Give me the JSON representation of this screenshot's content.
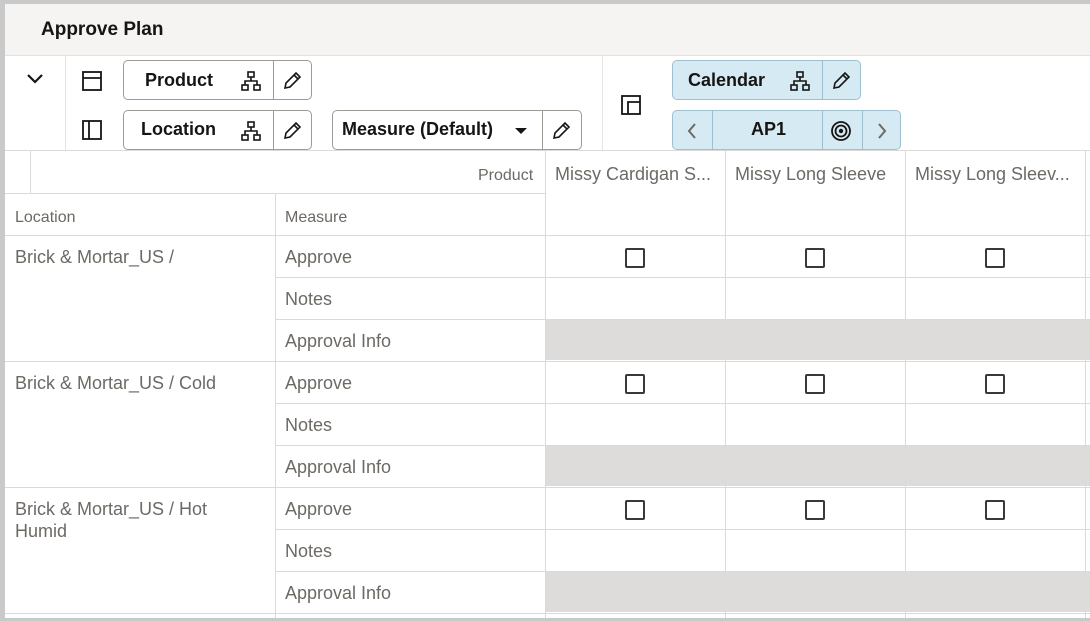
{
  "page": {
    "title": "Approve Plan"
  },
  "toolbar": {
    "product": {
      "label": "Product"
    },
    "location": {
      "label": "Location"
    },
    "measure": {
      "label": "Measure (Default)"
    },
    "calendar": {
      "label": "Calendar"
    },
    "period": {
      "label": "AP1"
    }
  },
  "grid": {
    "corner_header": "Product",
    "row_headers": {
      "location": "Location",
      "measure": "Measure"
    },
    "columns": [
      "Missy Cardigan S...",
      "Missy Long Sleeve",
      "Missy Long Sleev..."
    ],
    "groups": [
      {
        "location": "Brick & Mortar_US /",
        "measures": [
          "Approve",
          "Notes",
          "Approval Info"
        ]
      },
      {
        "location": "Brick & Mortar_US / Cold",
        "measures": [
          "Approve",
          "Notes",
          "Approval Info"
        ]
      },
      {
        "location_line1": "Brick & Mortar_US / Hot",
        "location_line2": "Humid",
        "measures": [
          "Approve",
          "Notes",
          "Approval Info"
        ]
      }
    ]
  },
  "colors": {
    "highlight": "#d6eaf3",
    "readonly_cell": "#dddcdb",
    "border": "#9e9a95"
  }
}
